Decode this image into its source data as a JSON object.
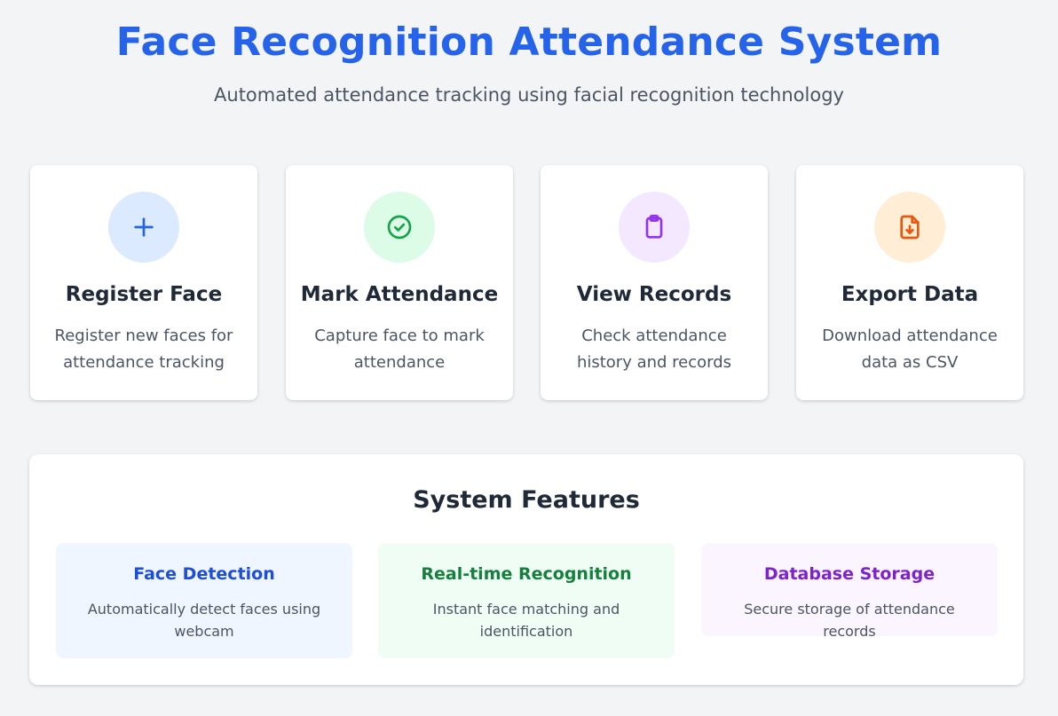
{
  "header": {
    "title": "Face Recognition Attendance System",
    "subtitle": "Automated attendance tracking using facial recognition technology"
  },
  "cards": [
    {
      "icon": "plus-icon",
      "title": "Register Face",
      "description": "Register new faces for attendance tracking",
      "icon_color": "#2563eb",
      "icon_bg": "#dbeafe"
    },
    {
      "icon": "check-circle-icon",
      "title": "Mark Attendance",
      "description": "Capture face to mark attendance",
      "icon_color": "#16a34a",
      "icon_bg": "#dcfce7"
    },
    {
      "icon": "clipboard-icon",
      "title": "View Records",
      "description": "Check attendance history and records",
      "icon_color": "#9333ea",
      "icon_bg": "#f3e8ff"
    },
    {
      "icon": "file-download-icon",
      "title": "Export Data",
      "description": "Download attendance data as CSV",
      "icon_color": "#ea580c",
      "icon_bg": "#ffedd5"
    }
  ],
  "features": {
    "title": "System Features",
    "items": [
      {
        "title": "Face Detection",
        "description": "Automatically detect faces using webcam",
        "title_color": "#1d4ed8",
        "bg": "#eff6ff"
      },
      {
        "title": "Real-time Recognition",
        "description": "Instant face matching and identification",
        "title_color": "#15803d",
        "bg": "#f0fdf4"
      },
      {
        "title": "Database Storage",
        "description": "Secure storage of attendance records",
        "title_color": "#7e22ce",
        "bg": "#faf5ff"
      }
    ]
  }
}
